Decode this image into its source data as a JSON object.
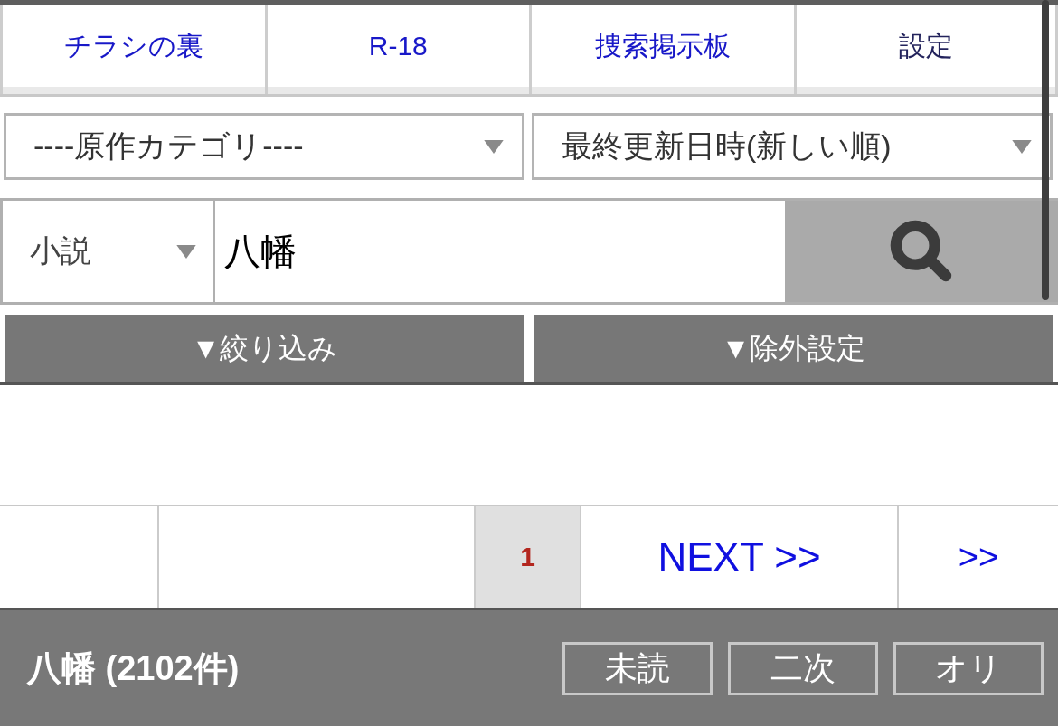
{
  "nav_tabs": [
    {
      "label": "チラシの裏",
      "visited": false
    },
    {
      "label": "R-18",
      "visited": false
    },
    {
      "label": "捜索掲示板",
      "visited": false
    },
    {
      "label": "設定",
      "visited": true
    }
  ],
  "sort_filters": [
    {
      "value": "----原作カテゴリ----"
    },
    {
      "value": "最終更新日時(新しい順)"
    }
  ],
  "search": {
    "type_select": {
      "value": "小説"
    },
    "query": {
      "value": "八幡"
    }
  },
  "toggle_buttons": [
    {
      "label": "▼絞り込み"
    },
    {
      "label": "▼除外設定"
    }
  ],
  "pagination": [
    {
      "kind": "blank"
    },
    {
      "kind": "blank"
    },
    {
      "kind": "page",
      "label": "1",
      "selected": true
    },
    {
      "kind": "link",
      "label": "NEXT >>"
    },
    {
      "kind": "link",
      "label": ">>"
    }
  ],
  "result_bar": {
    "title": "八幡 (2102件)",
    "buttons": [
      {
        "label": "未読"
      },
      {
        "label": "二次"
      },
      {
        "label": "オリ"
      }
    ]
  }
}
